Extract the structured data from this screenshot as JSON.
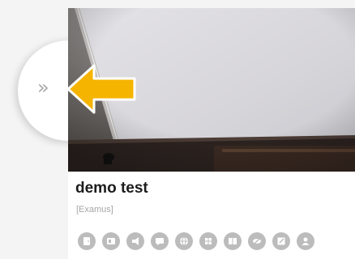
{
  "sidebar": {
    "expand_label": "»"
  },
  "card": {
    "title": "demo test",
    "provider": "[Examus]",
    "action_icons": [
      "door-icon",
      "id-card-icon",
      "megaphone-icon",
      "chat-icon",
      "globe-icon",
      "grid-icon",
      "book-icon",
      "eye-off-icon",
      "edit-icon",
      "person-icon"
    ]
  },
  "colors": {
    "annotation_arrow": "#F5B400",
    "icon_fill": "#BCBCBC",
    "title_text": "#1C1C1C",
    "provider_text": "#A6A6A6"
  }
}
